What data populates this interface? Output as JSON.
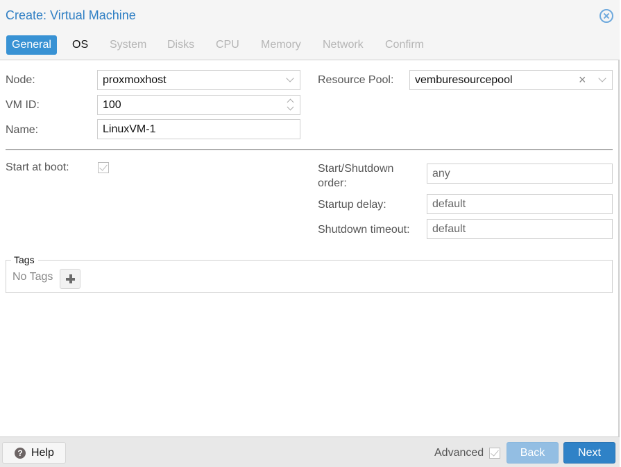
{
  "window": {
    "title": "Create: Virtual Machine",
    "accent_color": "#3892d4"
  },
  "tabs": [
    {
      "label": "General",
      "state": "active"
    },
    {
      "label": "OS",
      "state": "enabled"
    },
    {
      "label": "System",
      "state": "disabled"
    },
    {
      "label": "Disks",
      "state": "disabled"
    },
    {
      "label": "CPU",
      "state": "disabled"
    },
    {
      "label": "Memory",
      "state": "disabled"
    },
    {
      "label": "Network",
      "state": "disabled"
    },
    {
      "label": "Confirm",
      "state": "disabled"
    }
  ],
  "general": {
    "node": {
      "label": "Node:",
      "value": "proxmoxhost"
    },
    "vmid": {
      "label": "VM ID:",
      "value": "100"
    },
    "name": {
      "label": "Name:",
      "value": "LinuxVM-1"
    },
    "resource_pool": {
      "label": "Resource Pool:",
      "value": "vemburesourcepool"
    },
    "start_at_boot": {
      "label": "Start at boot:",
      "checked": true
    },
    "start_shutdown_order": {
      "label_line1": "Start/Shutdown",
      "label_line2": "order:",
      "placeholder": "any"
    },
    "startup_delay": {
      "label": "Startup delay:",
      "placeholder": "default"
    },
    "shutdown_timeout": {
      "label": "Shutdown timeout:",
      "placeholder": "default"
    }
  },
  "tags": {
    "legend": "Tags",
    "empty_text": "No Tags"
  },
  "footer": {
    "help_label": "Help",
    "advanced_label": "Advanced",
    "advanced_checked": true,
    "back_label": "Back",
    "next_label": "Next"
  }
}
